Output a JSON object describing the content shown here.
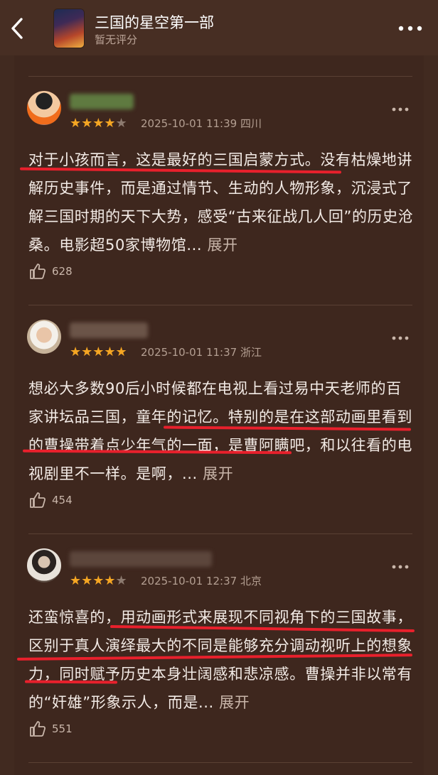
{
  "header": {
    "title": "三国的星空第一部",
    "subtitle": "暂无评分"
  },
  "reviews": [
    {
      "rating": 4,
      "date": "2025-10-01 11:39",
      "location": "四川",
      "text": "对于小孩而言，这是最好的三国启蒙方式。没有枯燥地讲解历史事件，而是通过情节、生动的人物形象，沉浸式了解三国时期的天下大势，感受“古来征战几人回”的历史沧桑。电影超50家博物馆...",
      "expand_label": "展开",
      "likes": "628"
    },
    {
      "rating": 5,
      "date": "2025-10-01 11:37",
      "location": "浙江",
      "text": "想必大多数90后小时候都在电视上看过易中天老师的百家讲坛品三国，童年的记忆。特别的是在这部动画里看到的曹操带着点少年气的一面，是曹阿瞒吧，和以往看的电视剧里不一样。是啊，...",
      "expand_label": "展开",
      "likes": "454"
    },
    {
      "rating": 4,
      "date": "2025-10-01 12:37",
      "location": "北京",
      "text": "还蛮惊喜的，用动画形式来展现不同视角下的三国故事，区别于真人演绎最大的不同是能够充分调动视听上的想象力，同时赋予历史本身壮阔感和悲凉感。曹操并非以常有的“奸雄”形象示人，而是...",
      "expand_label": "展开",
      "likes": "551"
    }
  ],
  "colors": {
    "background": "#3e271e",
    "star": "#f5a623",
    "underline": "#e8202c"
  }
}
